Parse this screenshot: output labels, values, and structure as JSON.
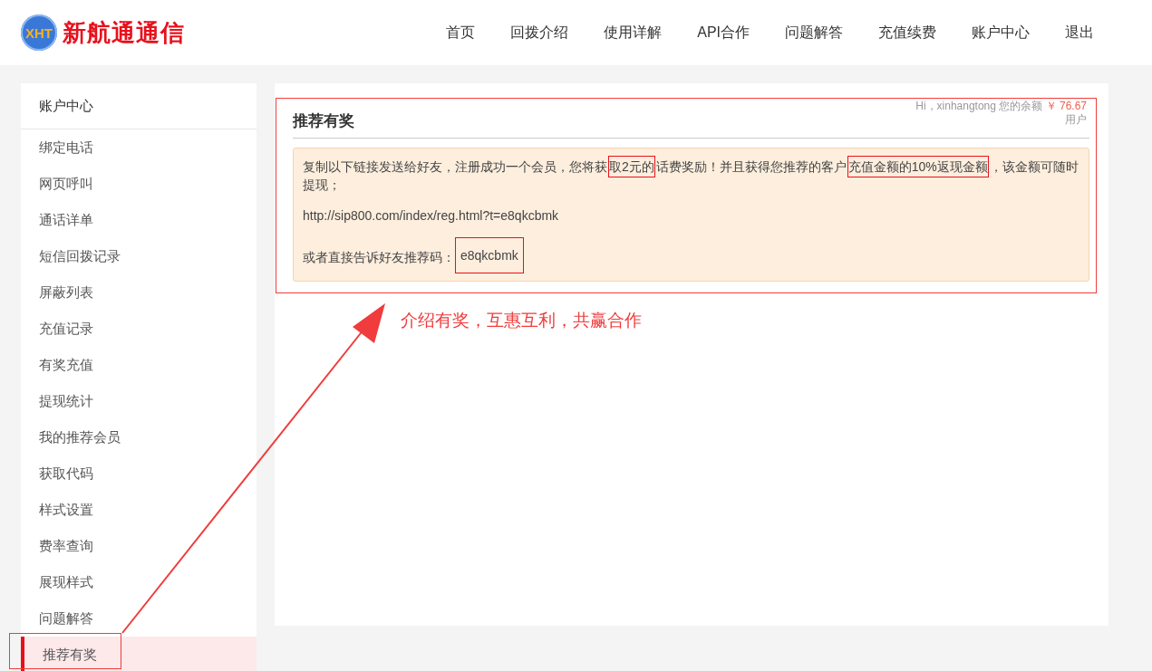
{
  "logo": {
    "mark": "XHT",
    "name": "新航通通信"
  },
  "nav": [
    {
      "label": "首页"
    },
    {
      "label": "回拨介绍"
    },
    {
      "label": "使用详解"
    },
    {
      "label": "API合作"
    },
    {
      "label": "问题解答"
    },
    {
      "label": "充值续费"
    },
    {
      "label": "账户中心"
    },
    {
      "label": "退出"
    }
  ],
  "sidebar": {
    "title": "账户中心",
    "items": [
      {
        "label": "绑定电话",
        "selected": false
      },
      {
        "label": "网页呼叫",
        "selected": false
      },
      {
        "label": "通话详单",
        "selected": false
      },
      {
        "label": "短信回拨记录",
        "selected": false
      },
      {
        "label": "屏蔽列表",
        "selected": false
      },
      {
        "label": "充值记录",
        "selected": false
      },
      {
        "label": "有奖充值",
        "selected": false
      },
      {
        "label": "提现统计",
        "selected": false
      },
      {
        "label": "我的推荐会员",
        "selected": false
      },
      {
        "label": "获取代码",
        "selected": false
      },
      {
        "label": "样式设置",
        "selected": false
      },
      {
        "label": "费率查询",
        "selected": false
      },
      {
        "label": "展现样式",
        "selected": false
      },
      {
        "label": "问题解答",
        "selected": false
      },
      {
        "label": "推荐有奖",
        "selected": true
      }
    ]
  },
  "panel": {
    "title": "推荐有奖",
    "greeting": "Hi，xinhangtong 您的余额",
    "balance": "￥ 76.67",
    "user_type": "用户",
    "intro": [
      {
        "text": "复制以下链接发送给好友，注册成功一个会员，您将获",
        "highlighted": false
      },
      {
        "text": "取2元的",
        "highlighted": true
      },
      {
        "text": "话费奖励！并且获得您推荐的客户",
        "highlighted": false
      },
      {
        "text": "充值金额的10%返现金额",
        "highlighted": true
      },
      {
        "text": "，该金额可随时提现；",
        "highlighted": false
      }
    ],
    "link": "http://sip800.com/index/reg.html?t=e8qkcbmk",
    "code_label": "或者直接告诉好友推荐码：",
    "code": "e8qkcbmk"
  },
  "annotation": {
    "caption": "介绍有奖，互惠互利，共赢合作"
  }
}
